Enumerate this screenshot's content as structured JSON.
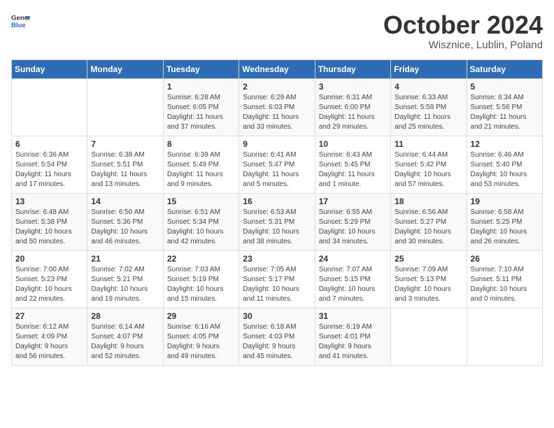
{
  "header": {
    "logo_line1": "General",
    "logo_line2": "Blue",
    "month": "October 2024",
    "location": "Wisznice, Lublin, Poland"
  },
  "days_of_week": [
    "Sunday",
    "Monday",
    "Tuesday",
    "Wednesday",
    "Thursday",
    "Friday",
    "Saturday"
  ],
  "weeks": [
    [
      {
        "day": "",
        "detail": ""
      },
      {
        "day": "",
        "detail": ""
      },
      {
        "day": "1",
        "detail": "Sunrise: 6:28 AM\nSunset: 6:05 PM\nDaylight: 11 hours\nand 37 minutes."
      },
      {
        "day": "2",
        "detail": "Sunrise: 6:29 AM\nSunset: 6:03 PM\nDaylight: 11 hours\nand 33 minutes."
      },
      {
        "day": "3",
        "detail": "Sunrise: 6:31 AM\nSunset: 6:00 PM\nDaylight: 11 hours\nand 29 minutes."
      },
      {
        "day": "4",
        "detail": "Sunrise: 6:33 AM\nSunset: 5:58 PM\nDaylight: 11 hours\nand 25 minutes."
      },
      {
        "day": "5",
        "detail": "Sunrise: 6:34 AM\nSunset: 5:56 PM\nDaylight: 11 hours\nand 21 minutes."
      }
    ],
    [
      {
        "day": "6",
        "detail": "Sunrise: 6:36 AM\nSunset: 5:54 PM\nDaylight: 11 hours\nand 17 minutes."
      },
      {
        "day": "7",
        "detail": "Sunrise: 6:38 AM\nSunset: 5:51 PM\nDaylight: 11 hours\nand 13 minutes."
      },
      {
        "day": "8",
        "detail": "Sunrise: 6:39 AM\nSunset: 5:49 PM\nDaylight: 11 hours\nand 9 minutes."
      },
      {
        "day": "9",
        "detail": "Sunrise: 6:41 AM\nSunset: 5:47 PM\nDaylight: 11 hours\nand 5 minutes."
      },
      {
        "day": "10",
        "detail": "Sunrise: 6:43 AM\nSunset: 5:45 PM\nDaylight: 11 hours\nand 1 minute."
      },
      {
        "day": "11",
        "detail": "Sunrise: 6:44 AM\nSunset: 5:42 PM\nDaylight: 10 hours\nand 57 minutes."
      },
      {
        "day": "12",
        "detail": "Sunrise: 6:46 AM\nSunset: 5:40 PM\nDaylight: 10 hours\nand 53 minutes."
      }
    ],
    [
      {
        "day": "13",
        "detail": "Sunrise: 6:48 AM\nSunset: 5:38 PM\nDaylight: 10 hours\nand 50 minutes."
      },
      {
        "day": "14",
        "detail": "Sunrise: 6:50 AM\nSunset: 5:36 PM\nDaylight: 10 hours\nand 46 minutes."
      },
      {
        "day": "15",
        "detail": "Sunrise: 6:51 AM\nSunset: 5:34 PM\nDaylight: 10 hours\nand 42 minutes."
      },
      {
        "day": "16",
        "detail": "Sunrise: 6:53 AM\nSunset: 5:31 PM\nDaylight: 10 hours\nand 38 minutes."
      },
      {
        "day": "17",
        "detail": "Sunrise: 6:55 AM\nSunset: 5:29 PM\nDaylight: 10 hours\nand 34 minutes."
      },
      {
        "day": "18",
        "detail": "Sunrise: 6:56 AM\nSunset: 5:27 PM\nDaylight: 10 hours\nand 30 minutes."
      },
      {
        "day": "19",
        "detail": "Sunrise: 6:58 AM\nSunset: 5:25 PM\nDaylight: 10 hours\nand 26 minutes."
      }
    ],
    [
      {
        "day": "20",
        "detail": "Sunrise: 7:00 AM\nSunset: 5:23 PM\nDaylight: 10 hours\nand 22 minutes."
      },
      {
        "day": "21",
        "detail": "Sunrise: 7:02 AM\nSunset: 5:21 PM\nDaylight: 10 hours\nand 19 minutes."
      },
      {
        "day": "22",
        "detail": "Sunrise: 7:03 AM\nSunset: 5:19 PM\nDaylight: 10 hours\nand 15 minutes."
      },
      {
        "day": "23",
        "detail": "Sunrise: 7:05 AM\nSunset: 5:17 PM\nDaylight: 10 hours\nand 11 minutes."
      },
      {
        "day": "24",
        "detail": "Sunrise: 7:07 AM\nSunset: 5:15 PM\nDaylight: 10 hours\nand 7 minutes."
      },
      {
        "day": "25",
        "detail": "Sunrise: 7:09 AM\nSunset: 5:13 PM\nDaylight: 10 hours\nand 3 minutes."
      },
      {
        "day": "26",
        "detail": "Sunrise: 7:10 AM\nSunset: 5:11 PM\nDaylight: 10 hours\nand 0 minutes."
      }
    ],
    [
      {
        "day": "27",
        "detail": "Sunrise: 6:12 AM\nSunset: 4:09 PM\nDaylight: 9 hours\nand 56 minutes."
      },
      {
        "day": "28",
        "detail": "Sunrise: 6:14 AM\nSunset: 4:07 PM\nDaylight: 9 hours\nand 52 minutes."
      },
      {
        "day": "29",
        "detail": "Sunrise: 6:16 AM\nSunset: 4:05 PM\nDaylight: 9 hours\nand 49 minutes."
      },
      {
        "day": "30",
        "detail": "Sunrise: 6:18 AM\nSunset: 4:03 PM\nDaylight: 9 hours\nand 45 minutes."
      },
      {
        "day": "31",
        "detail": "Sunrise: 6:19 AM\nSunset: 4:01 PM\nDaylight: 9 hours\nand 41 minutes."
      },
      {
        "day": "",
        "detail": ""
      },
      {
        "day": "",
        "detail": ""
      }
    ]
  ]
}
